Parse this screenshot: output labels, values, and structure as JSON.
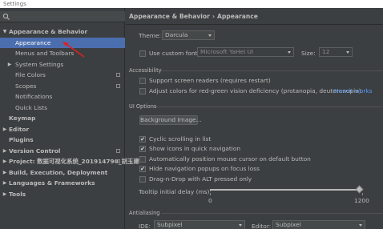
{
  "window": {
    "title": "Settings"
  },
  "search": {
    "placeholder": ""
  },
  "tree": {
    "items": [
      {
        "label": "Appearance & Behavior",
        "arrow": "▼",
        "bold": true
      },
      {
        "label": "Appearance",
        "selected": true
      },
      {
        "label": "Menus and Toolbars"
      },
      {
        "label": "System Settings",
        "arrow": "▶"
      },
      {
        "label": "File Colors",
        "badge": true
      },
      {
        "label": "Scopes",
        "badge": true
      },
      {
        "label": "Notifications"
      },
      {
        "label": "Quick Lists"
      },
      {
        "label": "Keymap",
        "bold": true
      },
      {
        "label": "Editor",
        "arrow": "▶",
        "bold": true
      },
      {
        "label": "Plugins",
        "bold": true
      },
      {
        "label": "Version Control",
        "arrow": "▶",
        "bold": true,
        "badge": true
      },
      {
        "label": "Project: 数据可视化系统_201914790_胡玉建",
        "arrow": "▶",
        "bold": true,
        "badge": true
      },
      {
        "label": "Build, Execution, Deployment",
        "arrow": "▶",
        "bold": true
      },
      {
        "label": "Languages & Frameworks",
        "arrow": "▶",
        "bold": true
      },
      {
        "label": "Tools",
        "arrow": "▶",
        "bold": true
      }
    ]
  },
  "breadcrumb": {
    "parent": "Appearance & Behavior",
    "separator": "›",
    "current": "Appearance"
  },
  "theme": {
    "label": "Theme:",
    "value": "Darcula"
  },
  "font": {
    "checkbox_label": "Use custom font:",
    "checked": false,
    "family": "Microsoft YaHei UI",
    "size_label": "Size:",
    "size": "12"
  },
  "accessibility": {
    "title": "Accessibility",
    "screen_readers": "Support screen readers (requires restart)",
    "screen_readers_checked": false,
    "color_adjust": "Adjust colors for red-green vision deficiency (protanopia, deuteranopia)",
    "color_adjust_checked": false,
    "how_it_works": "How it works"
  },
  "ui_options": {
    "title": "UI Options",
    "background_button": "Background Image...",
    "options": [
      {
        "label": "Cyclic scrolling in list",
        "checked": true
      },
      {
        "label": "Show icons in quick navigation",
        "checked": true
      },
      {
        "label": "Automatically position mouse cursor on default button",
        "checked": false
      },
      {
        "label": "Hide navigation popups on focus loss",
        "checked": true
      },
      {
        "label": "Drag-n-Drop with ALT pressed only",
        "checked": false
      }
    ],
    "tooltip_delay_label": "Tooltip initial delay (ms):",
    "tooltip_min": "0",
    "tooltip_max": "1200",
    "tooltip_value_fraction": 0.98
  },
  "antialiasing": {
    "title": "Antialiasing",
    "ide_label": "IDE:",
    "ide_value": "Subpixel",
    "editor_label": "Editor:",
    "editor_value": "Subpixel"
  },
  "colors": {
    "selection": "#4b6eaf",
    "link": "#589df6",
    "annotation_arrow": "#e02020"
  }
}
